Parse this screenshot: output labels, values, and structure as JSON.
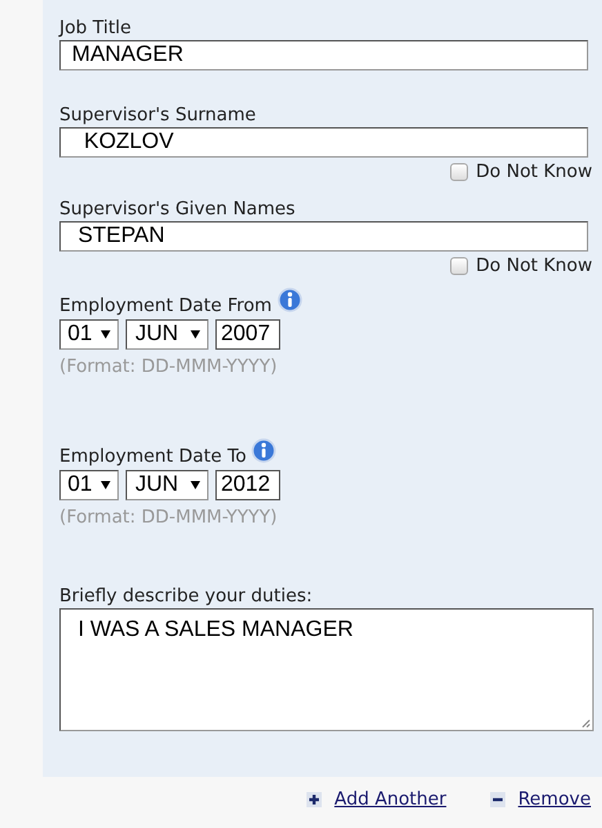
{
  "fields": [
    {
      "kind": "text",
      "label": "Job Title",
      "value": "MANAGER"
    },
    {
      "kind": "text",
      "label": "Supervisor's Surname",
      "value": "  KOZLOV",
      "do_not_know": {
        "label": "Do Not Know",
        "checked": false
      }
    },
    {
      "kind": "text",
      "label": "Supervisor's Given Names",
      "value": " STEPAN",
      "do_not_know": {
        "label": "Do Not Know",
        "checked": false
      }
    },
    {
      "kind": "date",
      "label": "Employment Date From",
      "day": "01",
      "month": "JUN",
      "year": "2007",
      "hint": "(Format: DD-MMM-YYYY)"
    },
    {
      "kind": "date",
      "label": "Employment Date To",
      "day": "01",
      "month": "JUN",
      "year": "2012",
      "hint": "(Format: DD-MMM-YYYY)"
    },
    {
      "kind": "textarea",
      "label": "Briefly describe your duties:",
      "value": " I WAS A SALES MANAGER"
    }
  ],
  "actions": [
    {
      "kind": "add",
      "label": "Add Another"
    },
    {
      "kind": "remove",
      "label": "Remove"
    }
  ]
}
